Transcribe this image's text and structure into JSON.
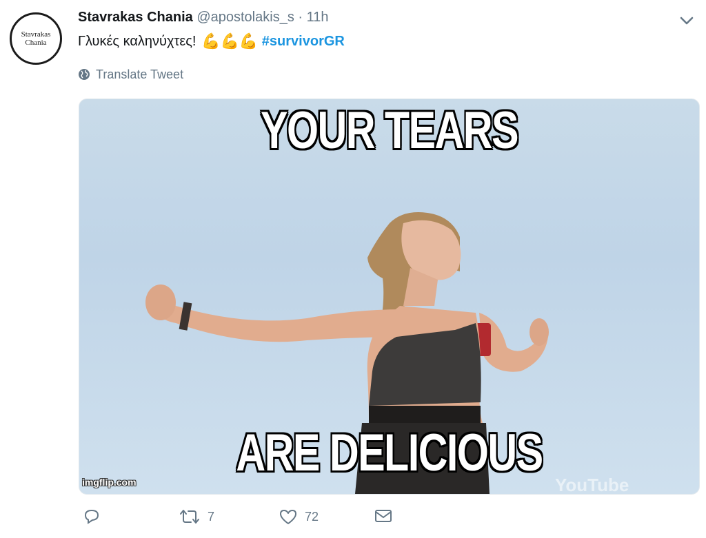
{
  "avatar": {
    "line1": "Stavrakas",
    "line2": "Chania"
  },
  "tweet": {
    "author_name": "Stavrakas Chania",
    "handle": "@apostolakis_s",
    "separator": "·",
    "time": "11h",
    "text": "Γλυκές καληνύχτες!",
    "emojis": "💪💪💪",
    "hashtag": "#survivorGR",
    "translate_label": "Translate Tweet"
  },
  "media": {
    "top_caption": "YOUR TEARS",
    "bottom_caption": "ARE DELICIOUS",
    "watermark": "imgflip.com",
    "youtube_mark": "YouTube"
  },
  "actions": {
    "reply_icon": "reply-icon",
    "retweet_icon": "retweet-icon",
    "retweet_count": "7",
    "like_icon": "heart-icon",
    "like_count": "72",
    "dm_icon": "mail-icon"
  },
  "colors": {
    "hashtag": "#1b95e0",
    "muted": "#657786",
    "text": "#14171a"
  }
}
